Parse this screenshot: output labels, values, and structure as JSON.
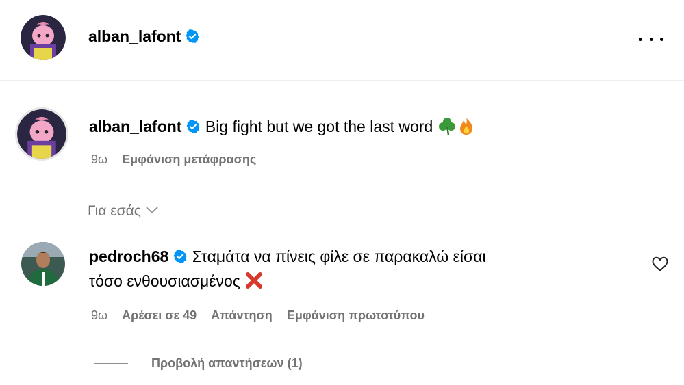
{
  "header": {
    "username": "alban_lafont",
    "verified_icon": "verified-badge-icon",
    "more_icon": "more-horizontal-icon"
  },
  "caption": {
    "username": "alban_lafont",
    "text": "Big fight but we got the last word",
    "emojis": [
      "shamrock-icon",
      "fire-icon"
    ],
    "time": "9ω",
    "translate_label": "Εμφάνιση μετάφρασης"
  },
  "sort": {
    "label": "Για εσάς",
    "icon": "chevron-down-icon"
  },
  "comment": {
    "username": "pedroch68",
    "text_line1": "Σταμάτα να πίνεις φίλε σε παρακαλώ είσαι",
    "text_line2": "τόσο ενθουσιασμένος",
    "emoji": "cross-mark-icon",
    "time": "9ω",
    "likes_label": "Αρέσει σε 49",
    "reply_label": "Απάντηση",
    "original_label": "Εμφάνιση πρωτοτύπου",
    "like_icon": "heart-outline-icon"
  },
  "replies": {
    "label": "Προβολή απαντήσεων (1)"
  },
  "colors": {
    "verified_blue": "#0095f6",
    "secondary_text": "#737373",
    "divider": "#efefef"
  }
}
